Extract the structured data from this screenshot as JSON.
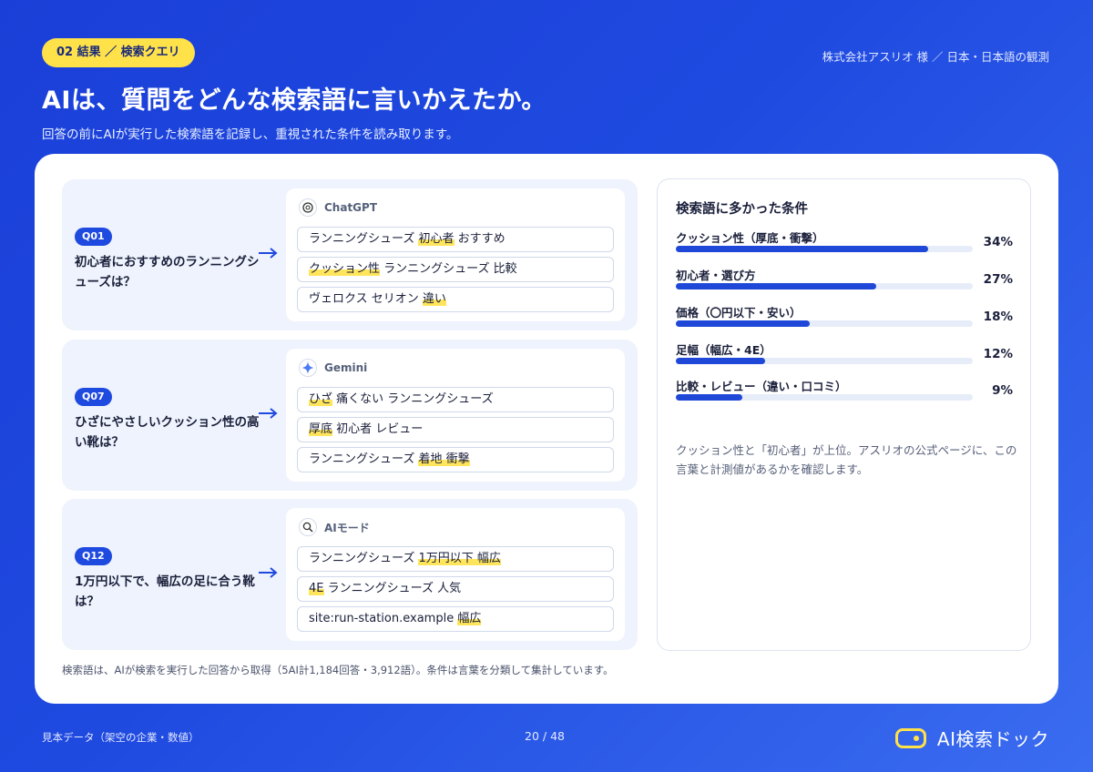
{
  "header": {
    "badge": "02 結果 ／ 検索クエリ",
    "client": "株式会社アスリオ 様 ／ 日本・日本語の観測",
    "title": "AIは、質問をどんな検索語に言いかえたか。",
    "subtitle": "回答の前にAIが実行した検索語を記録し、重視された条件を読み取ります。"
  },
  "questions": [
    {
      "id": "Q01",
      "text": "初心者におすすめのランニングシューズは？",
      "engine": "ChatGPT",
      "engine_icon": "chatgpt-icon",
      "queries": [
        [
          {
            "t": "ランニングシューズ "
          },
          {
            "t": "初心者",
            "hl": true
          },
          {
            "t": " おすすめ"
          }
        ],
        [
          {
            "t": "クッション性",
            "hl": true
          },
          {
            "t": " ランニングシューズ 比較"
          }
        ],
        [
          {
            "t": "ヴェロクス セリオン "
          },
          {
            "t": "違い",
            "hl": true
          }
        ]
      ]
    },
    {
      "id": "Q07",
      "text": "ひざにやさしいクッション性の高い靴は？",
      "engine": "Gemini",
      "engine_icon": "gemini-sparkle-icon",
      "queries": [
        [
          {
            "t": "ひざ",
            "hl": true
          },
          {
            "t": " 痛くない ランニングシューズ"
          }
        ],
        [
          {
            "t": "厚底",
            "hl": true
          },
          {
            "t": " 初心者 レビュー"
          }
        ],
        [
          {
            "t": "ランニングシューズ "
          },
          {
            "t": "着地 衝撃",
            "hl": true
          }
        ]
      ]
    },
    {
      "id": "Q12",
      "text": "1万円以下で、幅広の足に合う靴は？",
      "engine": "AIモード",
      "engine_icon": "ai-mode-search-icon",
      "queries": [
        [
          {
            "t": "ランニングシューズ "
          },
          {
            "t": "1万円以下 幅広",
            "hl": true
          }
        ],
        [
          {
            "t": "4E",
            "hl": true
          },
          {
            "t": " ランニングシューズ 人気"
          }
        ],
        [
          {
            "t": "site:run-station.example "
          },
          {
            "t": "幅広",
            "hl": true
          }
        ]
      ]
    }
  ],
  "conditions": {
    "title": "検索語に多かった条件",
    "items": [
      {
        "label": "クッション性（厚底・衝撃）",
        "value": 34,
        "pct": "34%"
      },
      {
        "label": "初心者・選び方",
        "value": 27,
        "pct": "27%"
      },
      {
        "label": "価格（〇円以下・安い）",
        "value": 18,
        "pct": "18%"
      },
      {
        "label": "足幅（幅広・4E）",
        "value": 12,
        "pct": "12%"
      },
      {
        "label": "比較・レビュー（違い・口コミ）",
        "value": 9,
        "pct": "9%"
      }
    ],
    "note": "クッション性と「初心者」が上位。アスリオの公式ページに、この言葉と計測値があるかを確認します。"
  },
  "footnote": "検索語は、AIが検索を実行した回答から取得（5AI計1,184回答・3,912語）。条件は言葉を分類して集計しています。",
  "footer": {
    "left": "見本データ（架空の企業・数値）",
    "page": "20 / 48",
    "brand": "AI検索ドック"
  },
  "colors": {
    "accent": "#1f4ae0",
    "highlight": "#ffe14a",
    "bar": "#1f48d8"
  }
}
